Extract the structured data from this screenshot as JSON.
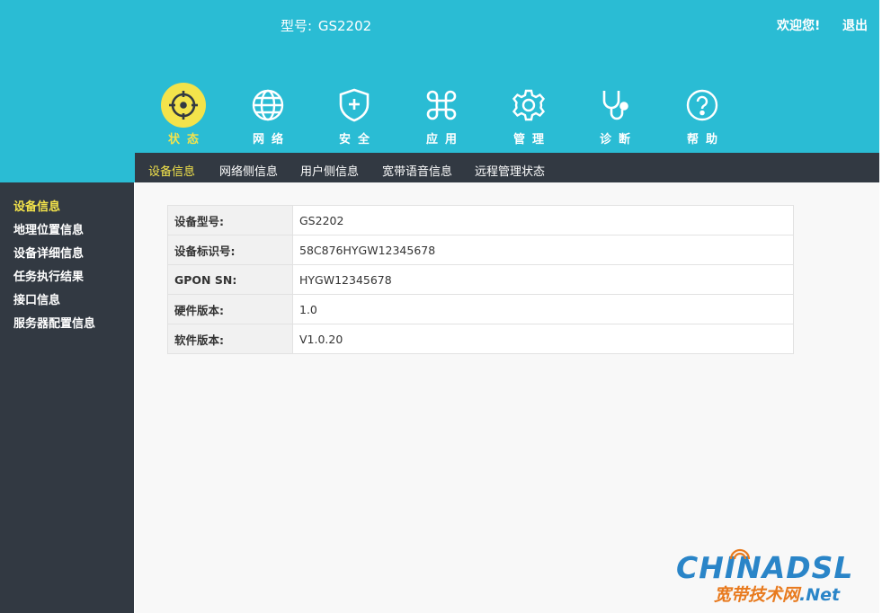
{
  "header": {
    "model_label": "型号:",
    "model_value": "GS2202",
    "welcome": "欢迎您!",
    "logout": "退出"
  },
  "nav": [
    {
      "label": "状态",
      "icon": "crosshair-icon",
      "active": true
    },
    {
      "label": "网络",
      "icon": "globe-icon"
    },
    {
      "label": "安全",
      "icon": "shield-plus-icon"
    },
    {
      "label": "应用",
      "icon": "command-icon"
    },
    {
      "label": "管理",
      "icon": "gear-icon"
    },
    {
      "label": "诊断",
      "icon": "stethoscope-icon"
    },
    {
      "label": "帮助",
      "icon": "question-icon"
    }
  ],
  "subnav": [
    "设备信息",
    "网络侧信息",
    "用户侧信息",
    "宽带语音信息",
    "远程管理状态"
  ],
  "sidebar": [
    "设备信息",
    "地理位置信息",
    "设备详细信息",
    "任务执行结果",
    "接口信息",
    "服务器配置信息"
  ],
  "device_info": [
    {
      "key": "设备型号:",
      "value": "GS2202"
    },
    {
      "key": "设备标识号:",
      "value": "58C876HYGW12345678"
    },
    {
      "key": "GPON SN:",
      "value": "HYGW12345678"
    },
    {
      "key": "硬件版本:",
      "value": "1.0"
    },
    {
      "key": "软件版本:",
      "value": "V1.0.20"
    }
  ],
  "watermark": {
    "brand": "CHINADSL",
    "cn": "宽带技术网",
    "net": ".Net"
  },
  "colors": {
    "header_bg": "#2abcd4",
    "dark_bg": "#323942",
    "accent": "#f3e34b"
  }
}
